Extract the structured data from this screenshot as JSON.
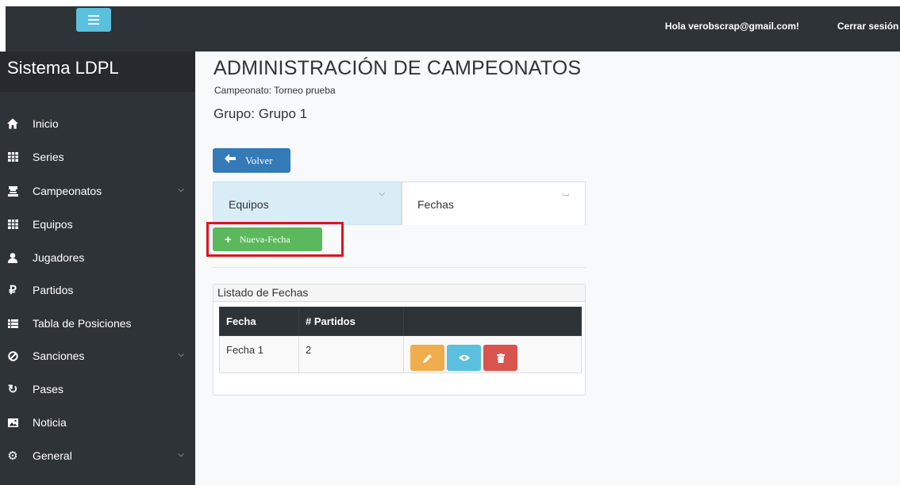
{
  "topbar": {
    "greeting": "Hola verobscrap@gmail.com!",
    "logout_label": "Cerrar sesión"
  },
  "sidebar": {
    "brand": "Sistema LDPL",
    "items": [
      {
        "label": "Inicio",
        "icon": "home-icon",
        "has_submenu": false
      },
      {
        "label": "Series",
        "icon": "grid-icon",
        "has_submenu": false
      },
      {
        "label": "Campeonatos",
        "icon": "trophy-icon",
        "has_submenu": true
      },
      {
        "label": "Equipos",
        "icon": "grid-icon",
        "has_submenu": false
      },
      {
        "label": "Jugadores",
        "icon": "user-icon",
        "has_submenu": false
      },
      {
        "label": "Partidos",
        "icon": "ruble-icon",
        "has_submenu": false
      },
      {
        "label": "Tabla de Posiciones",
        "icon": "list-icon",
        "has_submenu": false
      },
      {
        "label": "Sanciones",
        "icon": "ban-icon",
        "has_submenu": true
      },
      {
        "label": "Pases",
        "icon": "refresh-icon",
        "has_submenu": false
      },
      {
        "label": "Noticia",
        "icon": "image-icon",
        "has_submenu": false
      },
      {
        "label": "General",
        "icon": "gear-icon",
        "has_submenu": true
      }
    ]
  },
  "main": {
    "title": "ADMINISTRACIÓN DE CAMPEONATOS",
    "subtitle": "Campeonato: Torneo prueba",
    "group": "Grupo: Grupo 1",
    "back_label": "Volver",
    "tabs": [
      {
        "label": "Equipos",
        "active": true
      },
      {
        "label": "Fechas",
        "active": false
      }
    ],
    "new_button_label": "Nueva-Fecha",
    "panel_title": "Listado de Fechas",
    "table": {
      "headers": [
        "Fecha",
        "# Partidos",
        ""
      ],
      "rows": [
        {
          "fecha": "Fecha 1",
          "partidos": "2"
        }
      ]
    }
  },
  "colors": {
    "sidebar_bg": "#2e3338",
    "primary": "#337ab7",
    "success": "#5cb85c",
    "warning": "#f0ad4e",
    "info": "#5bc0de",
    "danger": "#d9534f",
    "highlight": "#e0121e"
  }
}
